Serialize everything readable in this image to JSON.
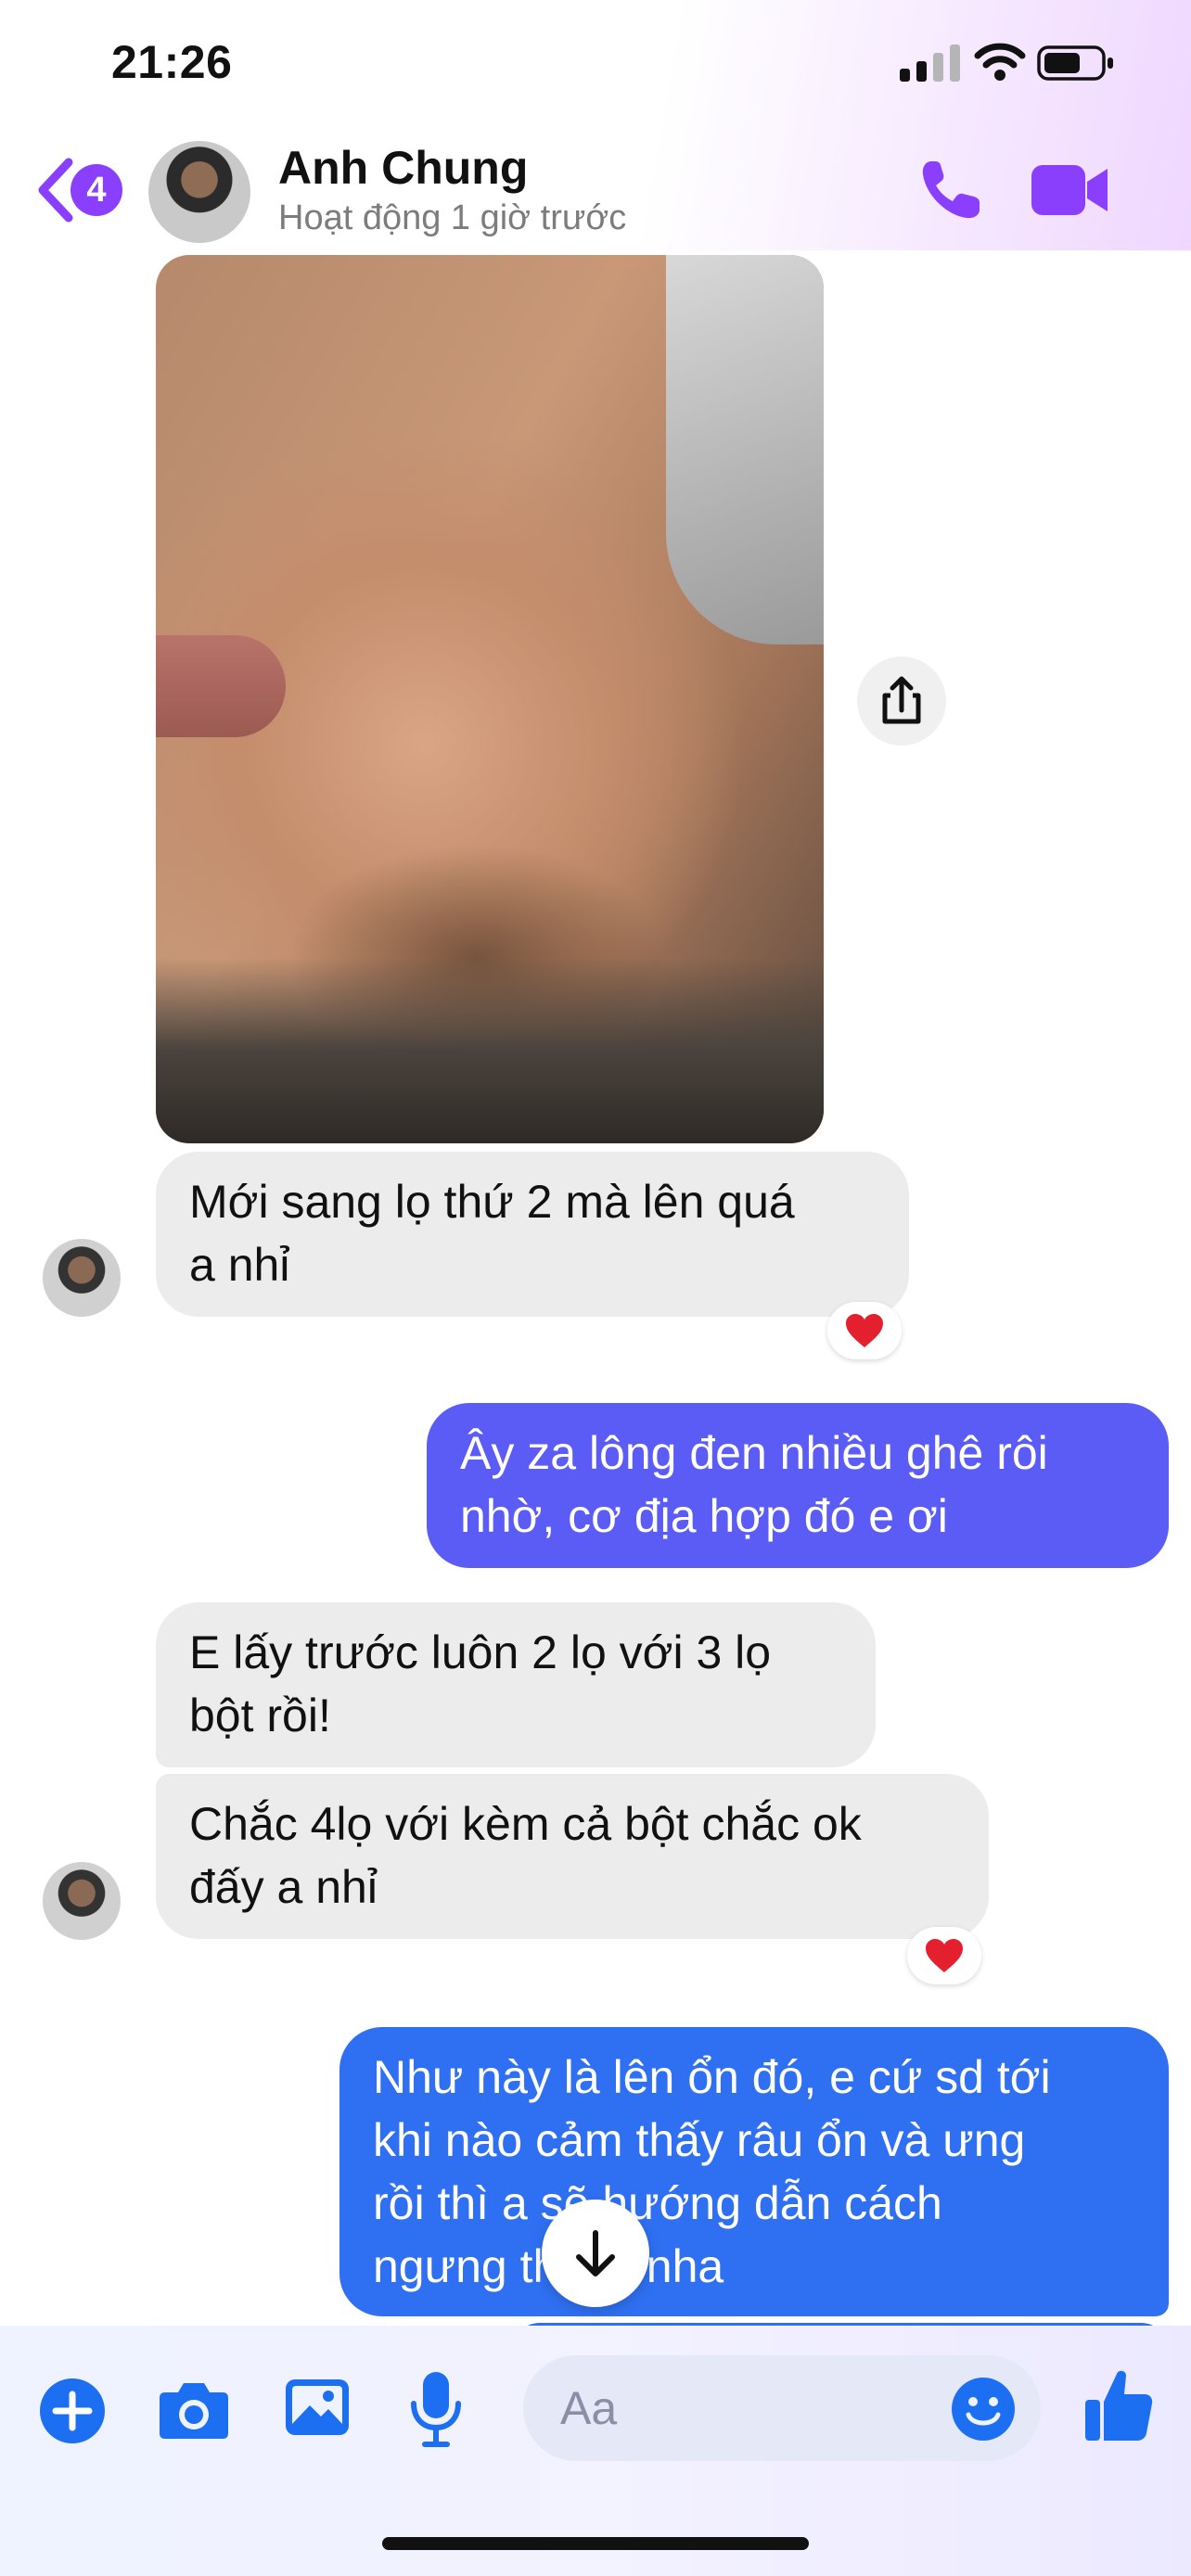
{
  "status_bar": {
    "time": "21:26"
  },
  "header": {
    "back_badge": "4",
    "contact_name": "Anh Chung",
    "contact_status": "Hoạt động 1 giờ trước",
    "accent_color": "#8a3ffc"
  },
  "messages": [
    {
      "sender": "contact",
      "text_lines": [
        "Mới sang lọ thứ 2 mà lên quá",
        "a nhỉ"
      ],
      "reaction": "heart"
    },
    {
      "sender": "me",
      "text_lines": [
        "Ây za lông đen nhiều ghê rôi",
        "nhờ, cơ địa hợp đó e ơi"
      ]
    },
    {
      "sender": "contact",
      "text_lines": [
        "E lấy trước luôn 2 lọ với 3 lọ",
        "bột rồi!"
      ]
    },
    {
      "sender": "contact",
      "text_lines": [
        "Chắc 4lọ với kèm cả bột chắc ok",
        "đấy a nhỉ"
      ],
      "reaction": "heart"
    },
    {
      "sender": "me",
      "text_lines": [
        "Như này là lên ổn đó, e cứ sd tới",
        "khi nào cảm thấy râu ổn và ưng",
        "rồi thì a sẽ hướng dẫn cách",
        "ngưng thuốc nha"
      ]
    }
  ],
  "composer": {
    "placeholder": "Aa"
  },
  "icons": {
    "back": "chevron-left-icon",
    "call": "phone-icon",
    "video": "video-camera-icon",
    "share": "share-icon",
    "add": "plus-circle-icon",
    "camera": "camera-icon",
    "gallery": "image-icon",
    "mic": "microphone-icon",
    "emoji": "smiley-icon",
    "like": "thumbs-up-icon",
    "scroll": "arrow-down-icon"
  },
  "colors": {
    "sent_violet": "#5a5cf5",
    "sent_blue": "#2f70f3",
    "received": "#ececec",
    "icon_blue": "#1d6ff2"
  }
}
